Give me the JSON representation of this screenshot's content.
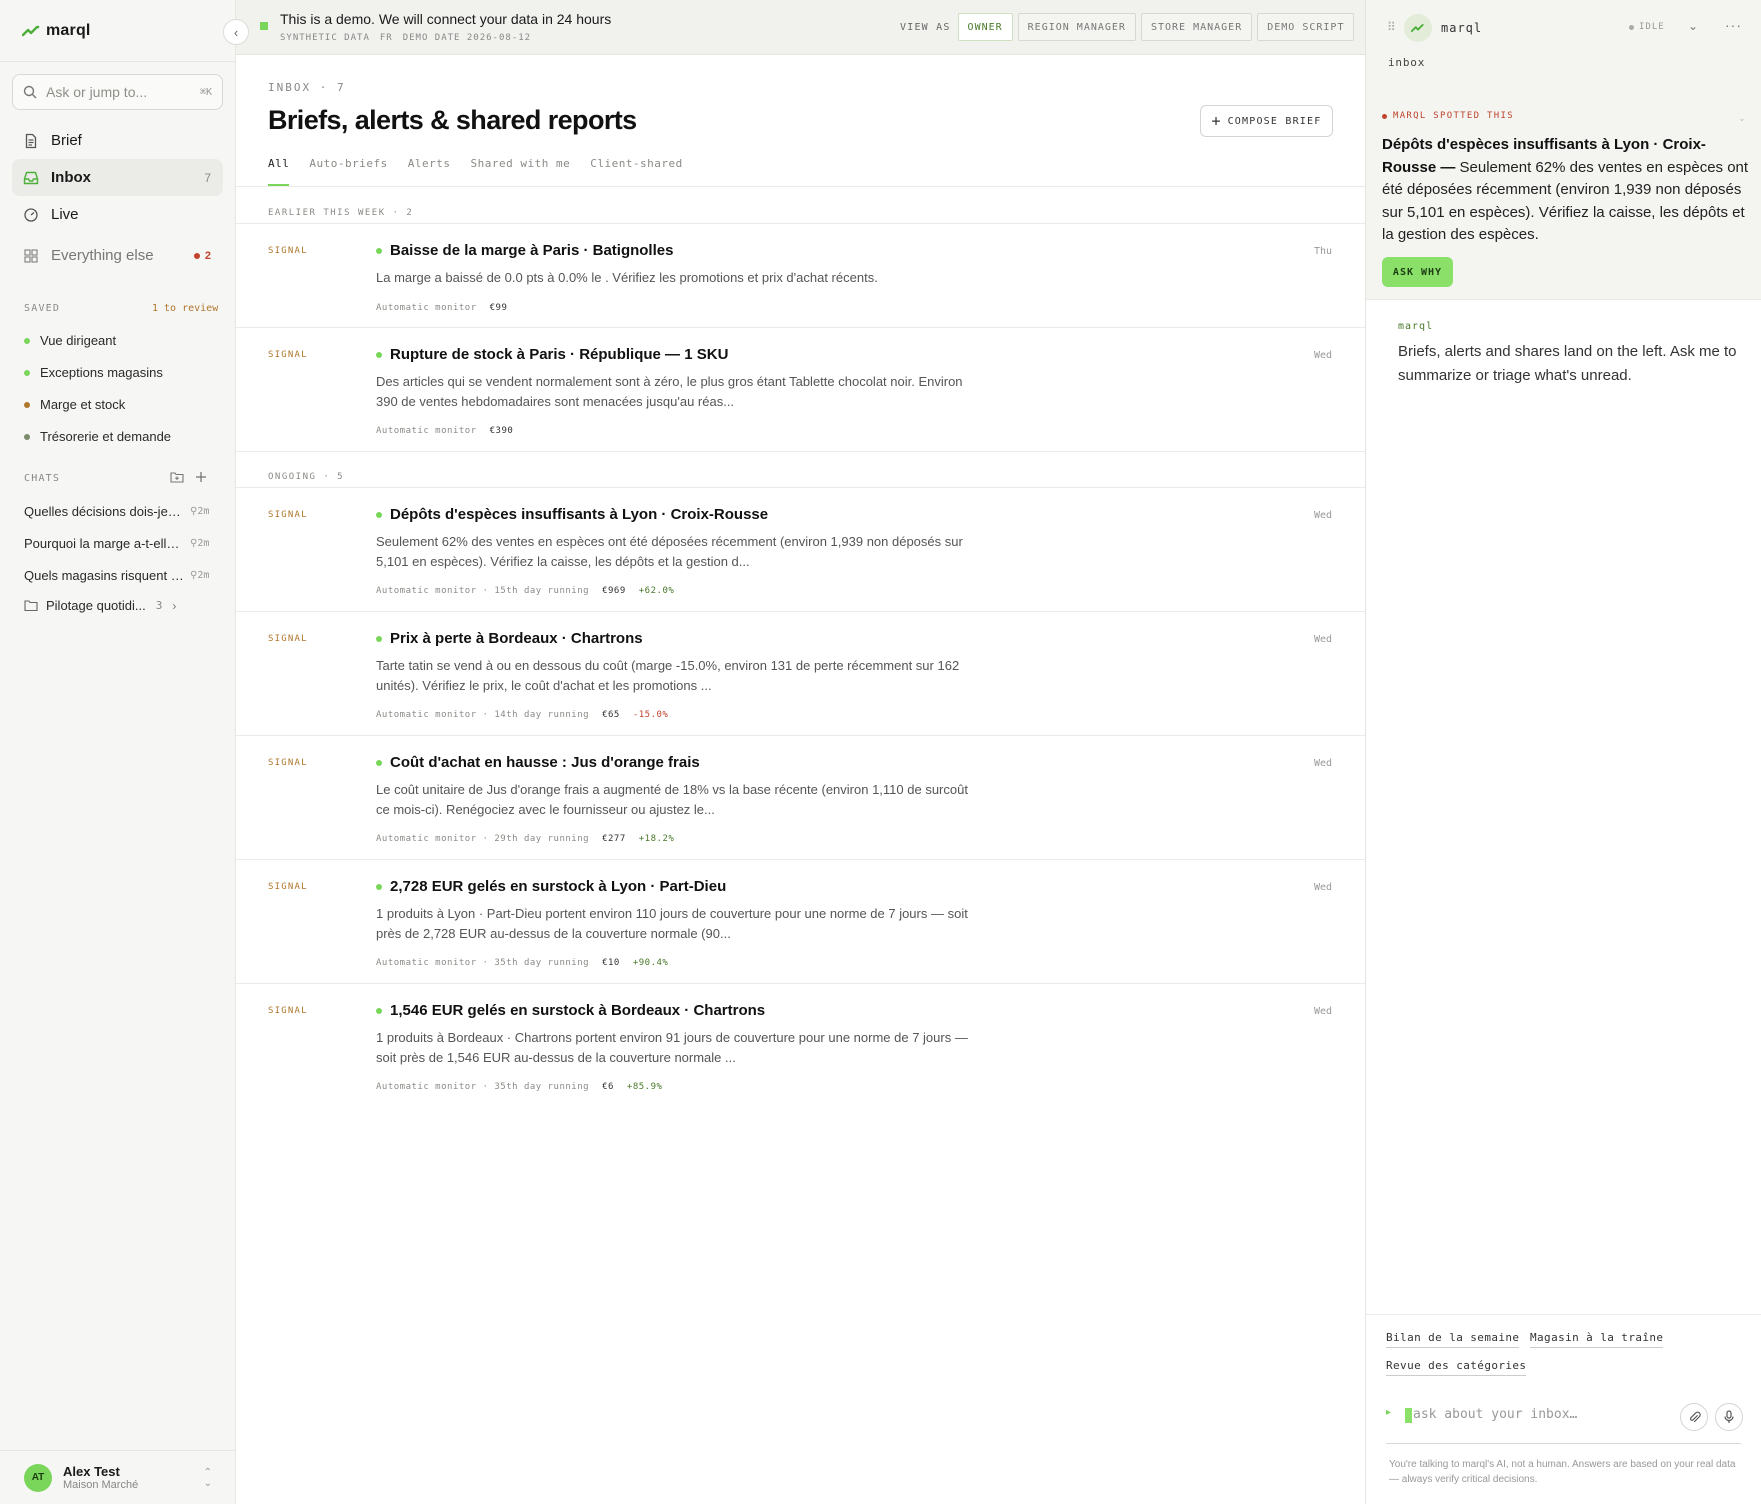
{
  "app": {
    "name": "marql",
    "colors": {
      "accent": "#7ad65a",
      "signal": "#b0762c",
      "alert": "#c0442e",
      "positive": "#4a7a2a"
    }
  },
  "sidebar": {
    "search_placeholder": "Ask or jump to...",
    "search_shortcut": "⌘K",
    "nav": [
      {
        "label": "Brief",
        "icon": "document-icon"
      },
      {
        "label": "Inbox",
        "icon": "inbox-icon",
        "count": "7"
      },
      {
        "label": "Live",
        "icon": "gauge-icon"
      },
      {
        "label": "Everything else",
        "icon": "grid-icon",
        "count": "2"
      }
    ],
    "saved_heading": "SAVED",
    "saved_review": "1 to review",
    "saved": [
      {
        "label": "Vue dirigeant",
        "color": "#7ad65a"
      },
      {
        "label": "Exceptions magasins",
        "color": "#7ad65a"
      },
      {
        "label": "Marge et stock",
        "color": "#b0762c"
      },
      {
        "label": "Trésorerie et demande",
        "color": "#7a8a6a"
      }
    ],
    "chats_heading": "CHATS",
    "chats": [
      {
        "label": "Quelles décisions dois-je prendre",
        "time": "2m"
      },
      {
        "label": "Pourquoi la marge a-t-elle baissé",
        "time": "2m"
      },
      {
        "label": "Quels magasins risquent une rupture",
        "time": "2m"
      }
    ],
    "folder": {
      "label": "Pilotage quotidi...",
      "count": "3"
    },
    "user": {
      "initials": "AT",
      "name": "Alex Test",
      "org": "Maison Marché"
    }
  },
  "banner": {
    "title": "This is a demo. We will connect your data in 24 hours",
    "meta": [
      "SYNTHETIC DATA",
      "FR",
      "DEMO DATE 2026-08-12"
    ],
    "view_as_label": "VIEW AS",
    "roles": [
      "OWNER",
      "REGION MANAGER",
      "STORE MANAGER",
      "DEMO SCRIPT"
    ]
  },
  "main": {
    "crumb": "INBOX · 7",
    "title": "Briefs, alerts & shared reports",
    "compose_label": "COMPOSE BRIEF",
    "tabs": [
      "All",
      "Auto-briefs",
      "Alerts",
      "Shared with me",
      "Client-shared"
    ],
    "groups": [
      {
        "heading": "EARLIER THIS WEEK · 2"
      },
      {
        "heading": "ONGOING · 5"
      }
    ],
    "items": [
      {
        "tag": "SIGNAL",
        "title": "Baisse de la marge à Paris · Batignolles",
        "body": "La marge a baissé de 0.0 pts à 0.0% le . Vérifiez les promotions et prix d'achat récents.",
        "meta": "Automatic monitor",
        "value": "€99",
        "delta": "",
        "day": "Thu"
      },
      {
        "tag": "SIGNAL",
        "title": "Rupture de stock à Paris · République — 1 SKU",
        "body": "Des articles qui se vendent normalement sont à zéro, le plus gros étant Tablette chocolat noir. Environ 390 de ventes hebdomadaires sont menacées jusqu'au réas...",
        "meta": "Automatic monitor",
        "value": "€390",
        "delta": "",
        "day": "Wed"
      },
      {
        "tag": "SIGNAL",
        "title": "Dépôts d'espèces insuffisants à Lyon · Croix-Rousse",
        "body": "Seulement 62% des ventes en espèces ont été déposées récemment (environ 1,939 non déposés sur 5,101 en espèces). Vérifiez la caisse, les dépôts et la gestion d...",
        "meta": "Automatic monitor · 15th day running",
        "value": "€969",
        "delta": "+62.0%",
        "day": "Wed"
      },
      {
        "tag": "SIGNAL",
        "title": "Prix à perte à Bordeaux · Chartrons",
        "body": "Tarte tatin se vend à ou en dessous du coût (marge -15.0%, environ 131 de perte récemment sur 162 unités). Vérifiez le prix, le coût d'achat et les promotions ...",
        "meta": "Automatic monitor · 14th day running",
        "value": "€65",
        "delta": "-15.0%",
        "day": "Wed"
      },
      {
        "tag": "SIGNAL",
        "title": "Coût d'achat en hausse : Jus d'orange frais",
        "body": "Le coût unitaire de Jus d'orange frais a augmenté de 18% vs la base récente (environ 1,110 de surcoût ce mois-ci). Renégociez avec le fournisseur ou ajustez le...",
        "meta": "Automatic monitor · 29th day running",
        "value": "€277",
        "delta": "+18.2%",
        "day": "Wed"
      },
      {
        "tag": "SIGNAL",
        "title": "2,728 EUR gelés en surstock à Lyon · Part-Dieu",
        "body": "1 produits à Lyon · Part-Dieu portent environ 110 jours de couverture pour une norme de 7 jours — soit près de 2,728 EUR au-dessus de la couverture normale (90...",
        "meta": "Automatic monitor · 35th day running",
        "value": "€10",
        "delta": "+90.4%",
        "day": "Wed"
      },
      {
        "tag": "SIGNAL",
        "title": "1,546 EUR gelés en surstock à Bordeaux · Chartrons",
        "body": "1 produits à Bordeaux · Chartrons portent environ 91 jours de couverture pour une norme de 7 jours — soit près de 1,546 EUR au-dessus de la couverture normale ...",
        "meta": "Automatic monitor · 35th day running",
        "value": "€6",
        "delta": "+85.9%",
        "day": "Wed"
      }
    ]
  },
  "panel": {
    "name": "marql",
    "status": "IDLE",
    "context": "inbox",
    "spotted_heading": "MARQL SPOTTED THIS",
    "spotted_title": "Dépôts d'espèces insuffisants à Lyon · Croix-Rousse —",
    "spotted_body": " Seulement 62% des ventes en espèces ont été déposées récemment (environ 1,939 non déposés sur 5,101 en espèces). Vérifiez la caisse, les dépôts et la gestion des espèces.",
    "ask_why": "ASK WHY",
    "assistant_name": "marql",
    "assistant_text": "Briefs, alerts and shares land on the left. Ask me to summarize or triage what's unread.",
    "suggestions": [
      "Bilan de la semaine",
      "Magasin à la traîne",
      "Revue des catégories"
    ],
    "input_placeholder": "ask about your inbox…",
    "disclaimer": "You're talking to marql's AI, not a human. Answers are based on your real data — always verify critical decisions."
  }
}
